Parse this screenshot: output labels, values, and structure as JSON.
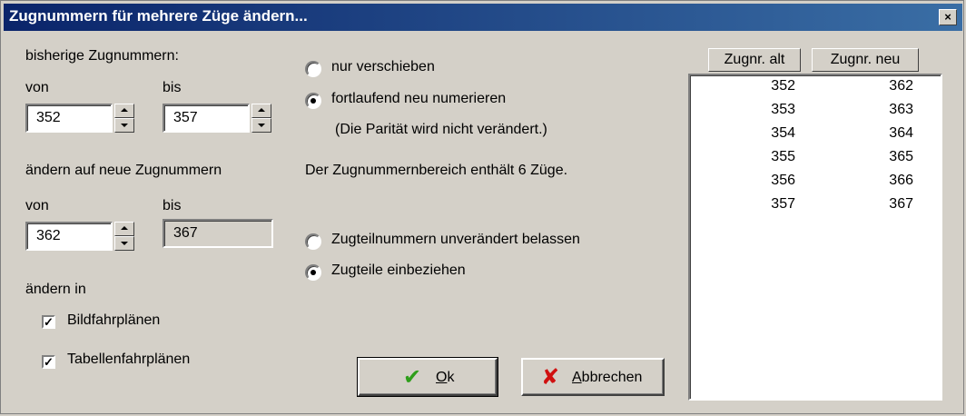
{
  "window": {
    "title": "Zugnummern für mehrere Züge ändern..."
  },
  "current": {
    "heading": "bisherige Zugnummern:",
    "from_label": "von",
    "from_value": "352",
    "to_label": "bis",
    "to_value": "357"
  },
  "newnums": {
    "heading": "ändern auf neue Zugnummern",
    "from_label": "von",
    "from_value": "362",
    "to_label": "bis",
    "to_value": "367"
  },
  "change_in": {
    "heading": "ändern in",
    "bildfahrplaene": "Bildfahrplänen",
    "tabellenfahrplaene": "Tabellenfahrplänen"
  },
  "mode": {
    "shift": "nur verschieben",
    "renumber": "fortlaufend neu numerieren",
    "parity_note": "(Die Parität wird nicht verändert.)",
    "info": "Der Zugnummernbereich enthält 6 Züge."
  },
  "parts": {
    "keep": "Zugteilnummern unverändert belassen",
    "include": "Zugteile einbeziehen"
  },
  "buttons": {
    "ok_mnemonic": "O",
    "ok_rest": "k",
    "cancel_mnemonic": "A",
    "cancel_rest": "bbrechen",
    "ok_icon": "checkmark-icon",
    "cancel_icon": "x-cross-icon"
  },
  "table": {
    "headers": [
      "Zugnr. alt",
      "Zugnr. neu"
    ],
    "rows": [
      [
        "352",
        "362"
      ],
      [
        "353",
        "363"
      ],
      [
        "354",
        "364"
      ],
      [
        "355",
        "365"
      ],
      [
        "356",
        "366"
      ],
      [
        "357",
        "367"
      ]
    ]
  },
  "colors": {
    "titlebar_start": "#0a246a",
    "titlebar_end": "#3a6ea5",
    "ok_icon": "#2e9e1a",
    "cancel_icon": "#d01010"
  }
}
